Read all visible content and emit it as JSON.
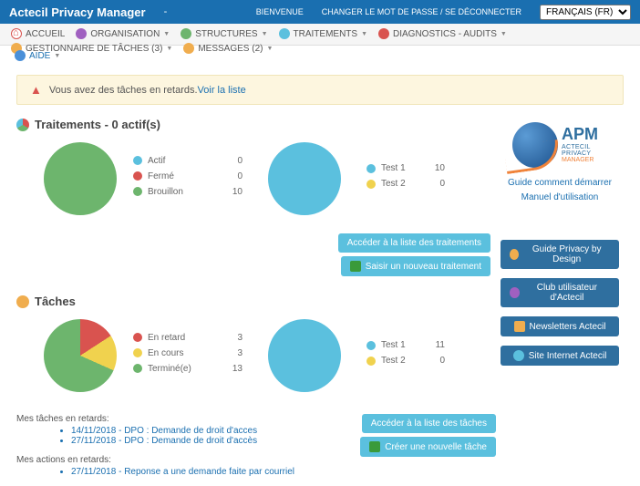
{
  "topbar": {
    "title": "Actecil Privacy Manager",
    "dash": "-",
    "welcome": "BIENVENUE",
    "changepw": "CHANGER LE MOT DE PASSE / SE DÉCONNECTER",
    "lang": "FRANÇAIS (FR)"
  },
  "menu": {
    "accueil": "ACCUEIL",
    "organisation": "ORGANISATION",
    "structures": "STRUCTURES",
    "traitements": "TRAITEMENTS",
    "diagnostics": "DIAGNOSTICS - AUDITS",
    "gestionnaire": "GESTIONNAIRE DE TÂCHES (3)",
    "messages": "MESSAGES (2)",
    "aide": "AIDE"
  },
  "alert": {
    "text": "Vous avez des tâches en retards. ",
    "link": "Voir la liste"
  },
  "sec1": {
    "title": "Traitements - 0 actif(s)",
    "legend": [
      {
        "label": "Actif",
        "value": "0",
        "color": "#5bc0de"
      },
      {
        "label": "Fermé",
        "value": "0",
        "color": "#d9534f"
      },
      {
        "label": "Brouillon",
        "value": "10",
        "color": "#6db56d"
      }
    ],
    "legend2": [
      {
        "label": "Test 1",
        "value": "10",
        "color": "#5bc0de"
      },
      {
        "label": "Test 2",
        "value": "0",
        "color": "#f0d24e"
      }
    ],
    "btn1": "Accéder à la liste des traitements",
    "btn2": "Saisir un nouveau traitement"
  },
  "sec2": {
    "title": "Tâches",
    "legend": [
      {
        "label": "En retard",
        "value": "3",
        "color": "#d9534f"
      },
      {
        "label": "En cours",
        "value": "3",
        "color": "#f0d24e"
      },
      {
        "label": "Terminé(e)",
        "value": "13",
        "color": "#6db56d"
      }
    ],
    "legend2": [
      {
        "label": "Test 1",
        "value": "11",
        "color": "#5bc0de"
      },
      {
        "label": "Test 2",
        "value": "0",
        "color": "#f0d24e"
      }
    ],
    "btn1": "Accéder à la liste des tâches",
    "btn2": "Créer une nouvelle tâche"
  },
  "side": {
    "logo1": "APM",
    "logo2": "ACTECIL PRIVACY",
    "logo3": "MANAGER",
    "link1": "Guide comment démarrer",
    "link2": "Manuel d'utilisation",
    "b1": "Guide Privacy by Design",
    "b2": "Club utilisateur d'Actecil",
    "b3": "Newsletters Actecil",
    "b4": "Site Internet Actecil"
  },
  "tasks": {
    "h1": "Mes tâches en retards:",
    "t1": "14/11/2018 - DPO : Demande de droit d'acces",
    "t2": "27/11/2018 - DPO : Demande de droit d'accès",
    "h2": "Mes actions en retards:",
    "a1": "27/11/2018 - Reponse a une demande faite par courriel"
  },
  "chart_data": [
    {
      "type": "pie",
      "title": "Traitements par statut",
      "series": [
        {
          "name": "Actif",
          "value": 0
        },
        {
          "name": "Fermé",
          "value": 0
        },
        {
          "name": "Brouillon",
          "value": 10
        }
      ]
    },
    {
      "type": "pie",
      "title": "Traitements par test",
      "series": [
        {
          "name": "Test 1",
          "value": 10
        },
        {
          "name": "Test 2",
          "value": 0
        }
      ]
    },
    {
      "type": "pie",
      "title": "Tâches par statut",
      "series": [
        {
          "name": "En retard",
          "value": 3
        },
        {
          "name": "En cours",
          "value": 3
        },
        {
          "name": "Terminé(e)",
          "value": 13
        }
      ]
    },
    {
      "type": "pie",
      "title": "Tâches par test",
      "series": [
        {
          "name": "Test 1",
          "value": 11
        },
        {
          "name": "Test 2",
          "value": 0
        }
      ]
    }
  ]
}
